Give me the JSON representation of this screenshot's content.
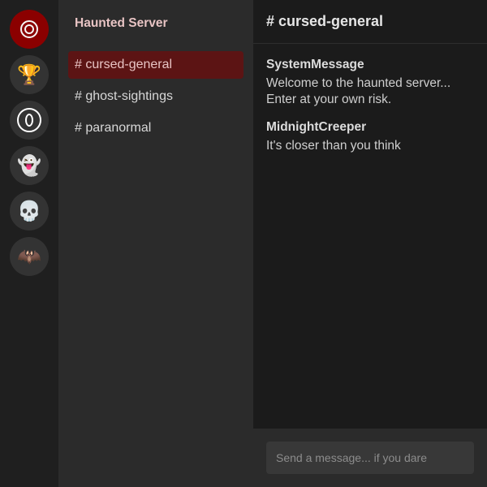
{
  "servers": [
    {
      "name": "ring",
      "icon": "ring-icon",
      "active": true
    },
    {
      "name": "trophy",
      "icon": "trophy-icon",
      "glyph": "🏆"
    },
    {
      "name": "zero",
      "icon": "zero-icon"
    },
    {
      "name": "ghost",
      "icon": "ghost-icon",
      "glyph": "👻"
    },
    {
      "name": "skull",
      "icon": "skull-icon",
      "glyph": "💀"
    },
    {
      "name": "bat",
      "icon": "bat-icon",
      "glyph": "🦇"
    }
  ],
  "sidebar": {
    "server_name": "Haunted Server",
    "channels": [
      {
        "label": "# cursed-general",
        "active": true
      },
      {
        "label": "# ghost-sightings"
      },
      {
        "label": "# paranormal"
      }
    ]
  },
  "chat": {
    "header": "# cursed-general",
    "messages": [
      {
        "author": "SystemMessage",
        "text": "Welcome to the haunted server...\nEnter at your own risk."
      },
      {
        "author": "MidnightCreeper",
        "text": "It's closer than you think"
      }
    ],
    "input_placeholder": "Send a message... if you dare"
  },
  "colors": {
    "active_server": "#8b0000",
    "active_channel": "#5c1414",
    "server_title": "#e8c4c4"
  }
}
